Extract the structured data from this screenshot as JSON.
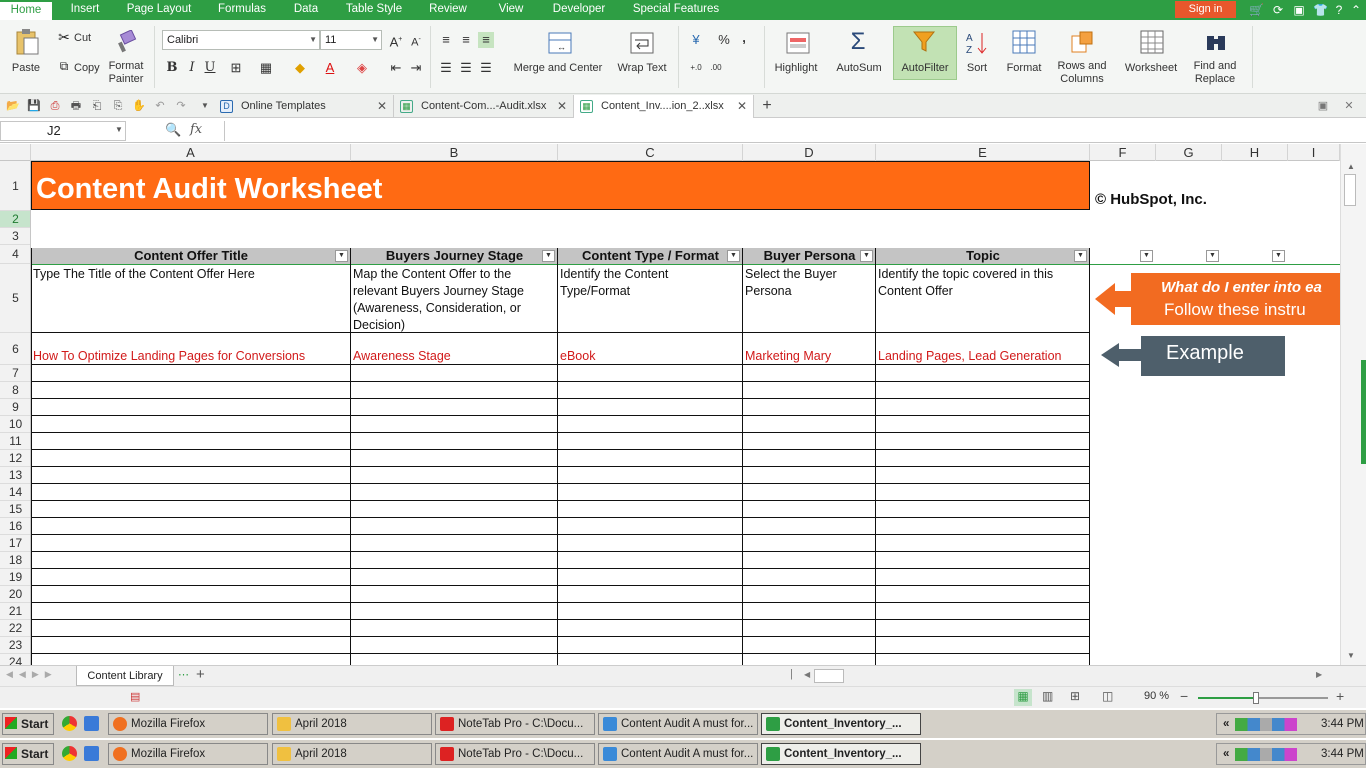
{
  "menu": {
    "items": [
      "Home",
      "Insert",
      "Page Layout",
      "Formulas",
      "Data",
      "Table Style",
      "Review",
      "View",
      "Developer",
      "Special Features"
    ],
    "signin": "Sign in"
  },
  "ribbon": {
    "paste": "Paste",
    "cut": "Cut",
    "copy": "Copy",
    "format_painter_1": "Format",
    "format_painter_2": "Painter",
    "font_name": "Calibri",
    "font_size": "11",
    "merge_center": "Merge and Center",
    "wrap_text": "Wrap Text",
    "highlight": "Highlight",
    "autosum": "AutoSum",
    "autofilter": "AutoFilter",
    "sort": "Sort",
    "format": "Format",
    "rows_cols_1": "Rows and",
    "rows_cols_2": "Columns",
    "worksheet": "Worksheet",
    "find_1": "Find and",
    "find_2": "Replace",
    "percent": "%",
    "comma": ","
  },
  "tabs": [
    {
      "label": "Online Templates"
    },
    {
      "label": "Content-Com...-Audit.xlsx"
    },
    {
      "label": "Content_Inv....ion_2..xlsx"
    }
  ],
  "formula_bar": {
    "cell_ref": "J2",
    "fx": "fx",
    "value": ""
  },
  "columns": [
    "A",
    "B",
    "C",
    "D",
    "E",
    "F",
    "G",
    "H",
    "I"
  ],
  "rows": [
    "1",
    "2",
    "3",
    "4",
    "5",
    "6",
    "7",
    "8",
    "9",
    "10",
    "11",
    "12",
    "13",
    "14",
    "15",
    "16",
    "17",
    "18",
    "19",
    "20",
    "21",
    "22",
    "23",
    "24"
  ],
  "sheet": {
    "title": "Content Audit Worksheet",
    "copyright": "© HubSpot, Inc.",
    "headers": [
      "Content Offer Title",
      "Buyers Journey Stage",
      "Content Type / Format",
      "Buyer Persona",
      "Topic"
    ],
    "instructions": [
      "Type The Title of the Content Offer Here",
      "Map the Content Offer to the relevant Buyers Journey Stage (Awareness, Consideration, or Decision)",
      "Identify the Content Type/Format",
      "Select the Buyer Persona",
      "Identify the topic covered in this Content Offer"
    ],
    "example": [
      "How To Optimize Landing Pages for Conversions",
      "Awareness Stage",
      "eBook",
      "Marketing Mary",
      "Landing Pages, Lead Generation"
    ],
    "callout_instructions_1": "What do I enter into ea",
    "callout_instructions_2": "Follow these instru",
    "callout_example": "Example",
    "header_color": "#ff6a13",
    "callout_orange": "#f26b21",
    "callout_slate": "#4e5f6b"
  },
  "sheet_tabs": [
    "Content Library"
  ],
  "status": {
    "zoom": "90 %"
  },
  "taskbar": {
    "start": "Start",
    "buttons": [
      "Mozilla Firefox",
      "April 2018",
      "NoteTab Pro  -  C:\\Docu...",
      "Content Audit A must for...",
      "Content_Inventory_..."
    ],
    "time": "3:44 PM"
  }
}
